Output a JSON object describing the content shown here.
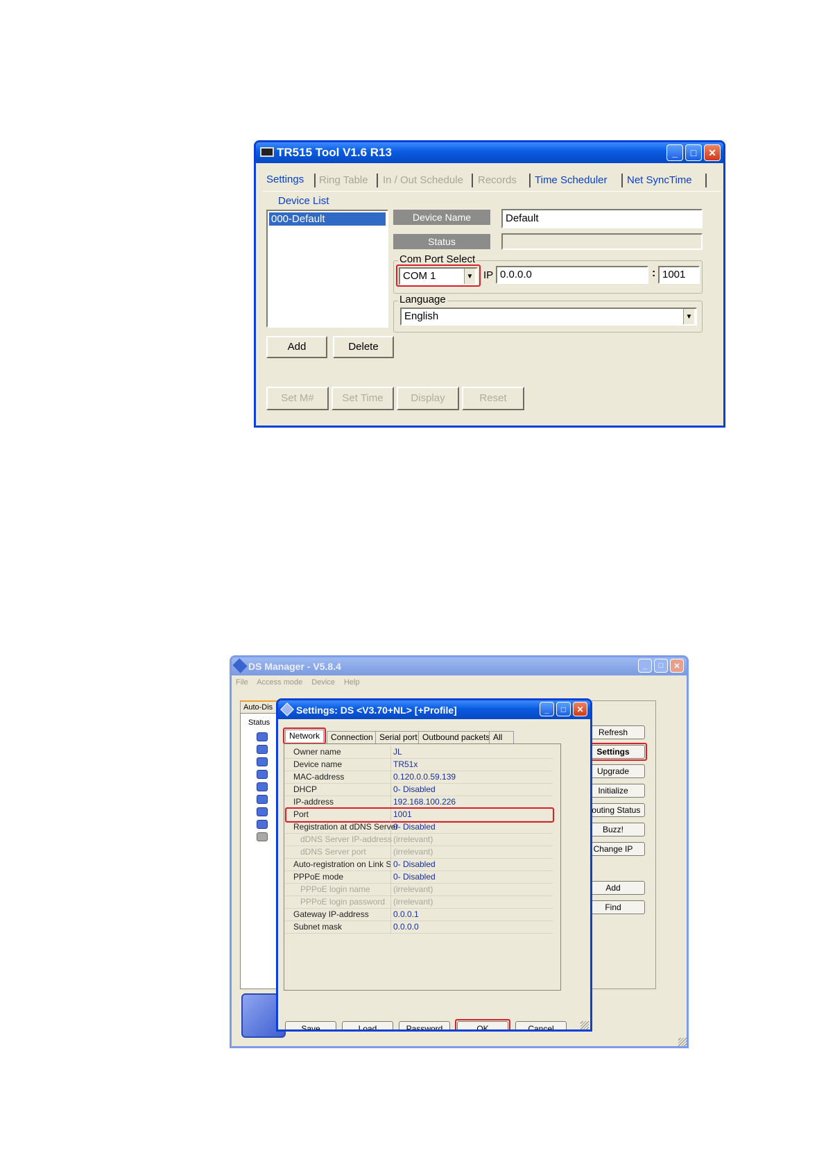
{
  "tr515": {
    "title": "TR515 Tool V1.6 R13",
    "tabs": [
      {
        "label": "Settings",
        "enabled": true
      },
      {
        "label": "Ring Table",
        "enabled": false
      },
      {
        "label": "In / Out Schedule",
        "enabled": false
      },
      {
        "label": "Records",
        "enabled": false
      },
      {
        "label": "Time Scheduler",
        "enabled": true
      },
      {
        "label": "Net SyncTime",
        "enabled": true
      }
    ],
    "device_list_label": "Device List",
    "device_list_items": [
      "000-Default"
    ],
    "device_name_label": "Device Name",
    "device_name_value": "Default",
    "status_label": "Status",
    "status_value": "",
    "com_port_group": "Com Port Select",
    "com_port_value": "COM 1",
    "ip_label": "IP",
    "ip_value": "0.0.0.0",
    "port_sep": ":",
    "port_value": "1001",
    "language_group": "Language",
    "language_value": "English",
    "add_button": "Add",
    "delete_button": "Delete",
    "bottom_buttons": [
      "Set M#",
      "Set Time",
      "Display",
      "Reset"
    ]
  },
  "ds_manager": {
    "title": "DS Manager - V5.8.4",
    "menu": [
      "File",
      "Access mode",
      "Device",
      "Help"
    ],
    "left_tab": "Auto-Dis",
    "status_header": "Status",
    "side_buttons": [
      "Refresh",
      "Settings",
      "Upgrade",
      "Initialize",
      "Routing Status",
      "Buzz!",
      "Change IP"
    ],
    "side_buttons_2": [
      "Add",
      "Find"
    ]
  },
  "settings_dialog": {
    "title": "Settings: DS <V3.70+NL> [+Profile]",
    "tabs": [
      "Network",
      "Connection",
      "Serial port",
      "Outbound packets",
      "All"
    ],
    "rows": [
      {
        "name": "Owner name",
        "value": "JL",
        "sub": false,
        "dim": false
      },
      {
        "name": "Device name",
        "value": "TR51x",
        "sub": false,
        "dim": false
      },
      {
        "name": "MAC-address",
        "value": "0.120.0.0.59.139",
        "sub": false,
        "dim": false
      },
      {
        "name": "DHCP",
        "value": "0- Disabled",
        "sub": false,
        "dim": false
      },
      {
        "name": "IP-address",
        "value": "192.168.100.226",
        "sub": false,
        "dim": false
      },
      {
        "name": "Port",
        "value": "1001",
        "sub": false,
        "dim": false
      },
      {
        "name": "Registration at dDNS Server",
        "value": "0- Disabled",
        "sub": false,
        "dim": false
      },
      {
        "name": "dDNS Server IP-address",
        "value": "(irrelevant)",
        "sub": true,
        "dim": true
      },
      {
        "name": "dDNS Server port",
        "value": "(irrelevant)",
        "sub": true,
        "dim": true
      },
      {
        "name": "Auto-registration on Link Serv",
        "value": "0- Disabled",
        "sub": false,
        "dim": false
      },
      {
        "name": "PPPoE mode",
        "value": "0- Disabled",
        "sub": false,
        "dim": false
      },
      {
        "name": "PPPoE login name",
        "value": "(irrelevant)",
        "sub": true,
        "dim": true
      },
      {
        "name": "PPPoE login password",
        "value": "(irrelevant)",
        "sub": true,
        "dim": true
      },
      {
        "name": "Gateway IP-address",
        "value": "0.0.0.1",
        "sub": false,
        "dim": false
      },
      {
        "name": "Subnet mask",
        "value": "0.0.0.0",
        "sub": false,
        "dim": false
      }
    ],
    "buttons": [
      "Save",
      "Load",
      "Password",
      "OK",
      "Cancel"
    ]
  },
  "colors": {
    "xp_title_blue": "#0a5ae0",
    "highlight_red": "#d8202a",
    "selection_blue": "#316ac5"
  }
}
